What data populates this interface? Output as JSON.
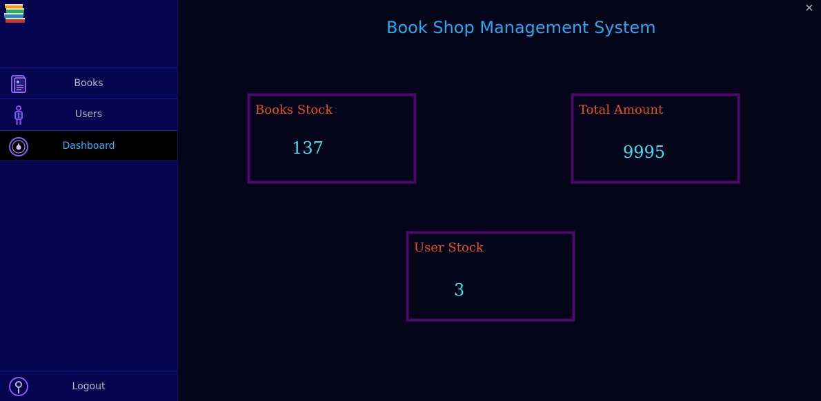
{
  "window": {
    "close_symbol": "✕"
  },
  "header": {
    "title": "Book Shop Management System"
  },
  "sidebar": {
    "logo_icon": "books-stack-icon",
    "items": [
      {
        "label": "Books",
        "icon": "book-icon"
      },
      {
        "label": "Users",
        "icon": "user-icon"
      },
      {
        "label": "Dashboard",
        "icon": "dashboard-icon",
        "active": true
      }
    ],
    "logout": {
      "label": "Logout",
      "icon": "logout-icon"
    }
  },
  "cards": {
    "books_stock": {
      "title": "Books Stock",
      "value": "137"
    },
    "total_amount": {
      "title": "Total Amount",
      "value": "9995"
    },
    "user_stock": {
      "title": "User Stock",
      "value": "3"
    }
  },
  "colors": {
    "sidebar_bg": "#050550",
    "main_bg": "#05051a",
    "accent_blue": "#27a8f0",
    "card_title": "#e8502a",
    "card_value": "#3de0f0",
    "card_border": "#4a0a6a"
  }
}
